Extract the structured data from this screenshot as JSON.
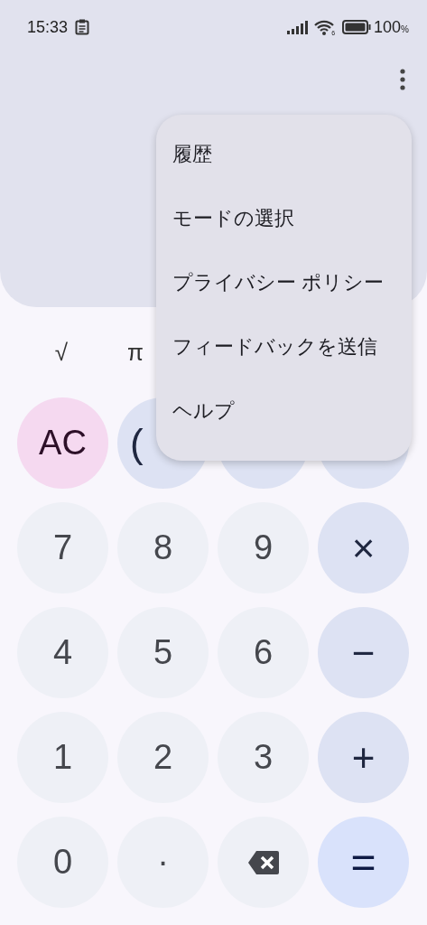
{
  "status_bar": {
    "time": "15:33",
    "wifi_badge": "6",
    "battery": "100",
    "battery_unit": "%"
  },
  "scientific_row": [
    "√",
    "π"
  ],
  "keys": [
    {
      "kind": "clear",
      "label": "AC"
    },
    {
      "kind": "op",
      "label": "("
    },
    {
      "kind": "op"
    },
    {
      "kind": "op"
    },
    {
      "kind": "digit",
      "label": "7"
    },
    {
      "kind": "digit",
      "label": "8"
    },
    {
      "kind": "digit",
      "label": "9"
    },
    {
      "kind": "op",
      "label": "×"
    },
    {
      "kind": "digit",
      "label": "4"
    },
    {
      "kind": "digit",
      "label": "5"
    },
    {
      "kind": "digit",
      "label": "6"
    },
    {
      "kind": "op",
      "label": "−"
    },
    {
      "kind": "digit",
      "label": "1"
    },
    {
      "kind": "digit",
      "label": "2"
    },
    {
      "kind": "digit",
      "label": "3"
    },
    {
      "kind": "op",
      "label": "+"
    },
    {
      "kind": "digit",
      "label": "0"
    },
    {
      "kind": "dot",
      "label": "·"
    },
    {
      "kind": "backspace"
    },
    {
      "kind": "equals",
      "label": "="
    }
  ],
  "menu": {
    "items": [
      "履歴",
      "モードの選択",
      "プライバシー ポリシー",
      "フィードバックを送信",
      "ヘルプ"
    ]
  }
}
